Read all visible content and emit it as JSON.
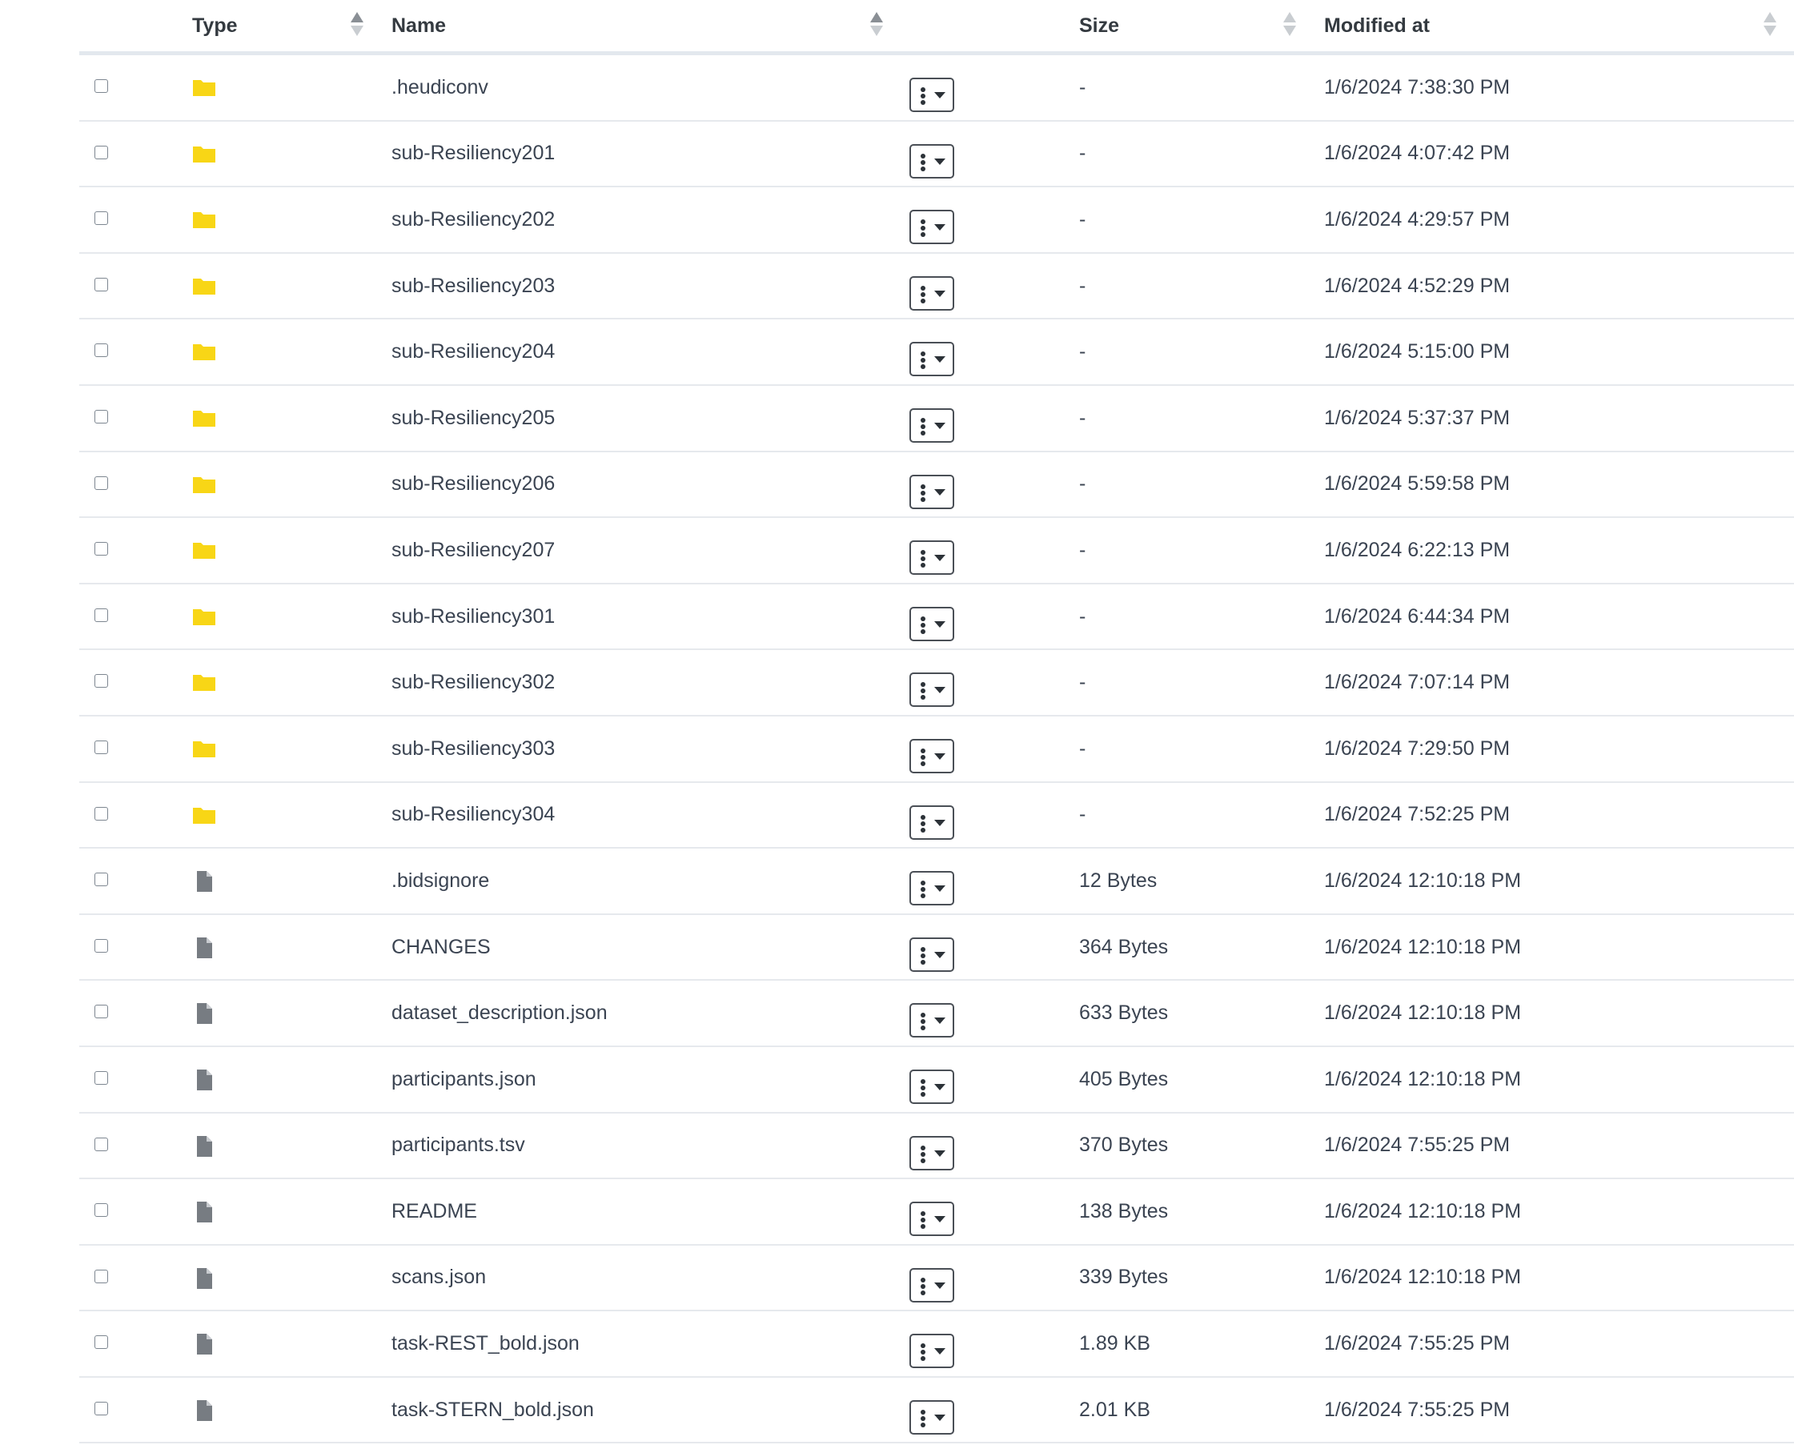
{
  "columns": {
    "type": "Type",
    "name": "Name",
    "size": "Size",
    "modified": "Modified at"
  },
  "colors": {
    "folder": "#f8d616",
    "file": "#777c82",
    "header_border": "#e3e8ee"
  },
  "rows": [
    {
      "type": "folder-icon",
      "name": ".heudiconv",
      "size": "-",
      "modified": "1/6/2024 7:38:30 PM"
    },
    {
      "type": "folder-icon",
      "name": "sub-Resiliency201",
      "size": "-",
      "modified": "1/6/2024 4:07:42 PM"
    },
    {
      "type": "folder-icon",
      "name": "sub-Resiliency202",
      "size": "-",
      "modified": "1/6/2024 4:29:57 PM"
    },
    {
      "type": "folder-icon",
      "name": "sub-Resiliency203",
      "size": "-",
      "modified": "1/6/2024 4:52:29 PM"
    },
    {
      "type": "folder-icon",
      "name": "sub-Resiliency204",
      "size": "-",
      "modified": "1/6/2024 5:15:00 PM"
    },
    {
      "type": "folder-icon",
      "name": "sub-Resiliency205",
      "size": "-",
      "modified": "1/6/2024 5:37:37 PM"
    },
    {
      "type": "folder-icon",
      "name": "sub-Resiliency206",
      "size": "-",
      "modified": "1/6/2024 5:59:58 PM"
    },
    {
      "type": "folder-icon",
      "name": "sub-Resiliency207",
      "size": "-",
      "modified": "1/6/2024 6:22:13 PM"
    },
    {
      "type": "folder-icon",
      "name": "sub-Resiliency301",
      "size": "-",
      "modified": "1/6/2024 6:44:34 PM"
    },
    {
      "type": "folder-icon",
      "name": "sub-Resiliency302",
      "size": "-",
      "modified": "1/6/2024 7:07:14 PM"
    },
    {
      "type": "folder-icon",
      "name": "sub-Resiliency303",
      "size": "-",
      "modified": "1/6/2024 7:29:50 PM"
    },
    {
      "type": "folder-icon",
      "name": "sub-Resiliency304",
      "size": "-",
      "modified": "1/6/2024 7:52:25 PM"
    },
    {
      "type": "file-icon",
      "name": ".bidsignore",
      "size": "12 Bytes",
      "modified": "1/6/2024 12:10:18 PM"
    },
    {
      "type": "file-icon",
      "name": "CHANGES",
      "size": "364 Bytes",
      "modified": "1/6/2024 12:10:18 PM"
    },
    {
      "type": "file-icon",
      "name": "dataset_description.json",
      "size": "633 Bytes",
      "modified": "1/6/2024 12:10:18 PM"
    },
    {
      "type": "file-icon",
      "name": "participants.json",
      "size": "405 Bytes",
      "modified": "1/6/2024 12:10:18 PM"
    },
    {
      "type": "file-icon",
      "name": "participants.tsv",
      "size": "370 Bytes",
      "modified": "1/6/2024 7:55:25 PM"
    },
    {
      "type": "file-icon",
      "name": "README",
      "size": "138 Bytes",
      "modified": "1/6/2024 12:10:18 PM"
    },
    {
      "type": "file-icon",
      "name": "scans.json",
      "size": "339 Bytes",
      "modified": "1/6/2024 12:10:18 PM"
    },
    {
      "type": "file-icon",
      "name": "task-REST_bold.json",
      "size": "1.89 KB",
      "modified": "1/6/2024 7:55:25 PM"
    },
    {
      "type": "file-icon",
      "name": "task-STERN_bold.json",
      "size": "2.01 KB",
      "modified": "1/6/2024 7:55:25 PM"
    }
  ]
}
